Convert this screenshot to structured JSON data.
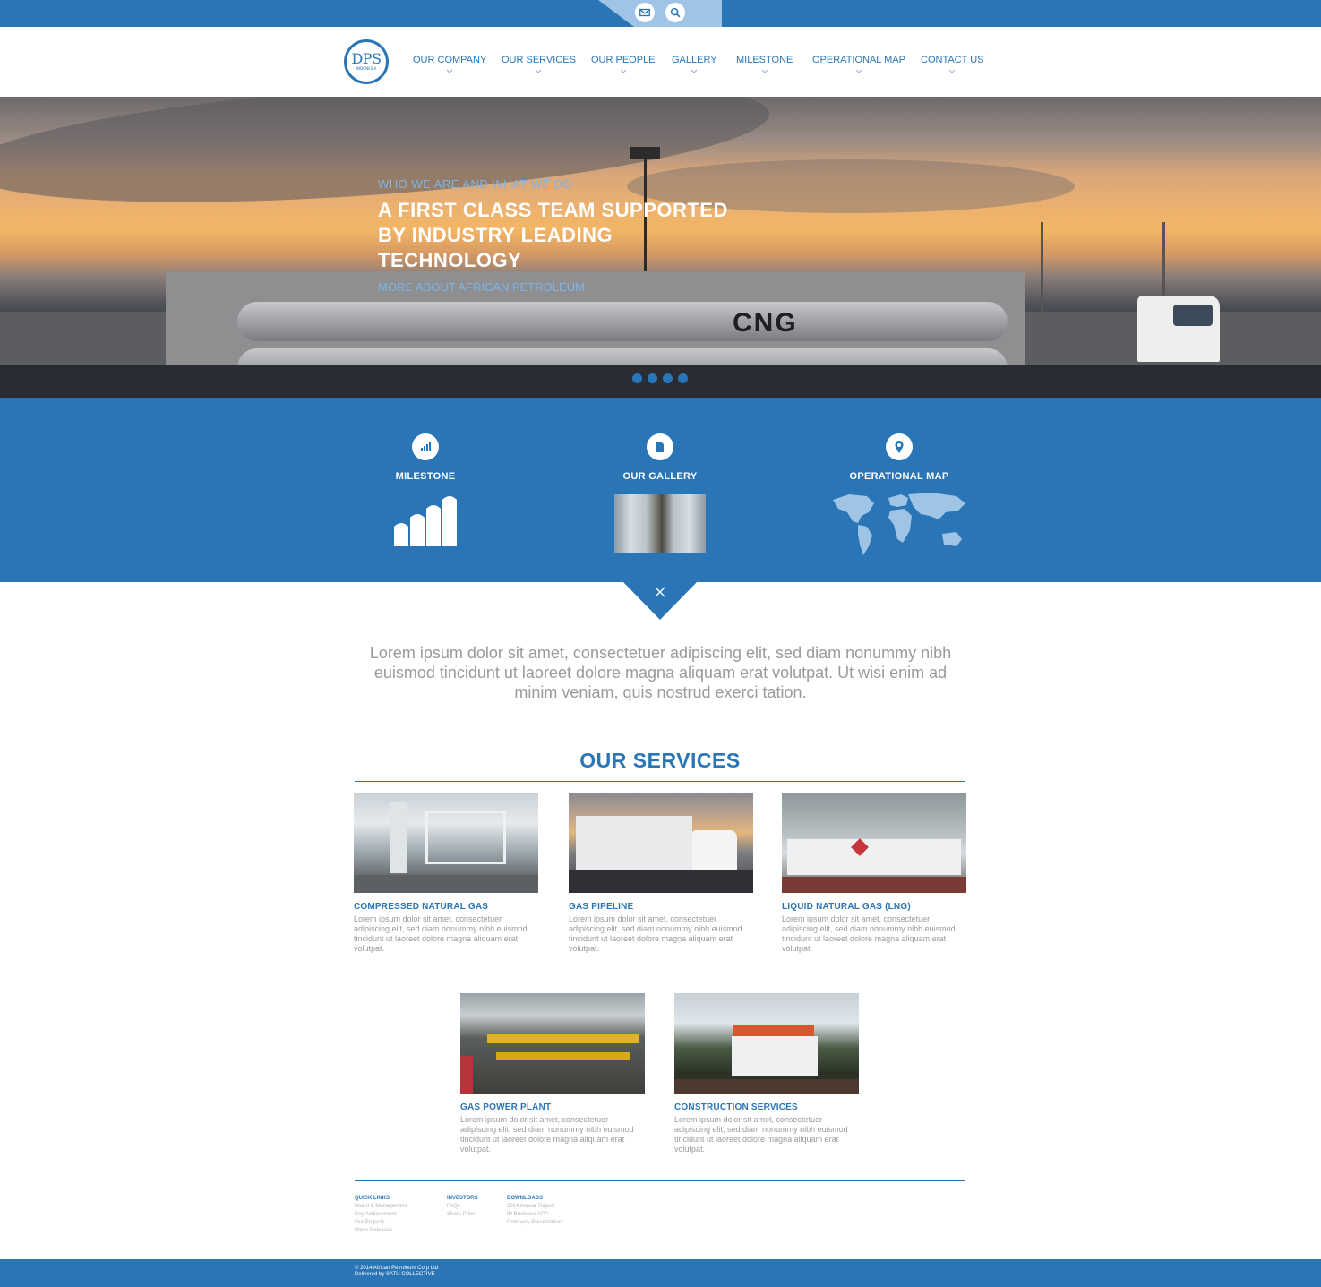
{
  "topbar": {
    "icons": [
      "mail-icon",
      "search-icon"
    ]
  },
  "header": {
    "logo": {
      "text": "DPS",
      "subtext": "INDONESIA"
    },
    "nav": [
      {
        "label": "OUR COMPANY"
      },
      {
        "label": "OUR SERVICES"
      },
      {
        "label": "OUR PEOPLE"
      },
      {
        "label": "GALLERY"
      },
      {
        "label": "MILESTONE"
      },
      {
        "label": "OPERATIONAL MAP"
      },
      {
        "label": "CONTACT US"
      }
    ]
  },
  "hero": {
    "kicker": "WHO WE ARE AND WHAT WE DO",
    "title_line1": "A FIRST CLASS TEAM SUPPORTED",
    "title_line2": "BY INDUSTRY LEADING TECHNOLOGY",
    "more": "MORE ABOUT AFRICAN PETROLEUM",
    "tank_label": "CNG",
    "slides_total": 4
  },
  "features": [
    {
      "label": "MILESTONE",
      "icon": "bar-chart-icon"
    },
    {
      "label": "OUR GALLERY",
      "icon": "document-icon"
    },
    {
      "label": "OPERATIONAL MAP",
      "icon": "map-pin-icon"
    }
  ],
  "intro": "Lorem ipsum dolor sit amet, consectetuer adipiscing elit, sed diam nonummy nibh euismod tincidunt ut laoreet dolore magna aliquam erat volutpat. Ut wisi enim ad minim veniam, quis nostrud exerci tation.",
  "services": {
    "title": "OUR SERVICES",
    "items": [
      {
        "name": "COMPRESSED NATURAL GAS",
        "desc": "Lorem ipsum dolor sit amet, consectetuer adipiscing elit, sed diam nonummy nibh euismod tincidunt ut laoreet dolore magna aliquam erat volutpat."
      },
      {
        "name": "GAS PIPELINE",
        "desc": "Lorem ipsum dolor sit amet, consectetuer adipiscing elit, sed diam nonummy nibh euismod tincidunt ut laoreet dolore magna aliquam erat volutpat."
      },
      {
        "name": "LIQUID NATURAL GAS (LNG)",
        "desc": "Lorem ipsum dolor sit amet, consectetuer adipiscing elit, sed diam nonummy nibh euismod tincidunt ut laoreet dolore magna aliquam erat volutpat."
      },
      {
        "name": "GAS POWER PLANT",
        "desc": "Lorem ipsum dolor sit amet, consectetuer adipiscing elit, sed diam nonummy nibh euismod tincidunt ut laoreet dolore magna aliquam erat volutpat."
      },
      {
        "name": "CONSTRUCTION SERVICES",
        "desc": "Lorem ipsum dolor sit amet, consectetuer adipiscing elit, sed diam nonummy nibh euismod tincidunt ut laoreet dolore magna aliquam erat volutpat."
      }
    ]
  },
  "footer": {
    "columns": [
      {
        "heading": "QUICK LINKS",
        "links": [
          "Board & Management",
          "Key Achievement",
          "Our Projects",
          "Press Releases"
        ]
      },
      {
        "heading": "INVESTORS",
        "links": [
          "FAQs",
          "Share Price"
        ]
      },
      {
        "heading": "DOWNLOADS",
        "links": [
          "2014 Annual Report",
          "IR Briefcase APP",
          "Company Presentation"
        ]
      }
    ],
    "copyright": "© 2014 African Petroleum Corp Ltd",
    "credit": "Delivered by SATU COLLECTIVE"
  },
  "colors": {
    "brand_blue": "#2a75b6",
    "light_blue": "#7fb4e4",
    "text_gray": "#9a9a9a"
  }
}
